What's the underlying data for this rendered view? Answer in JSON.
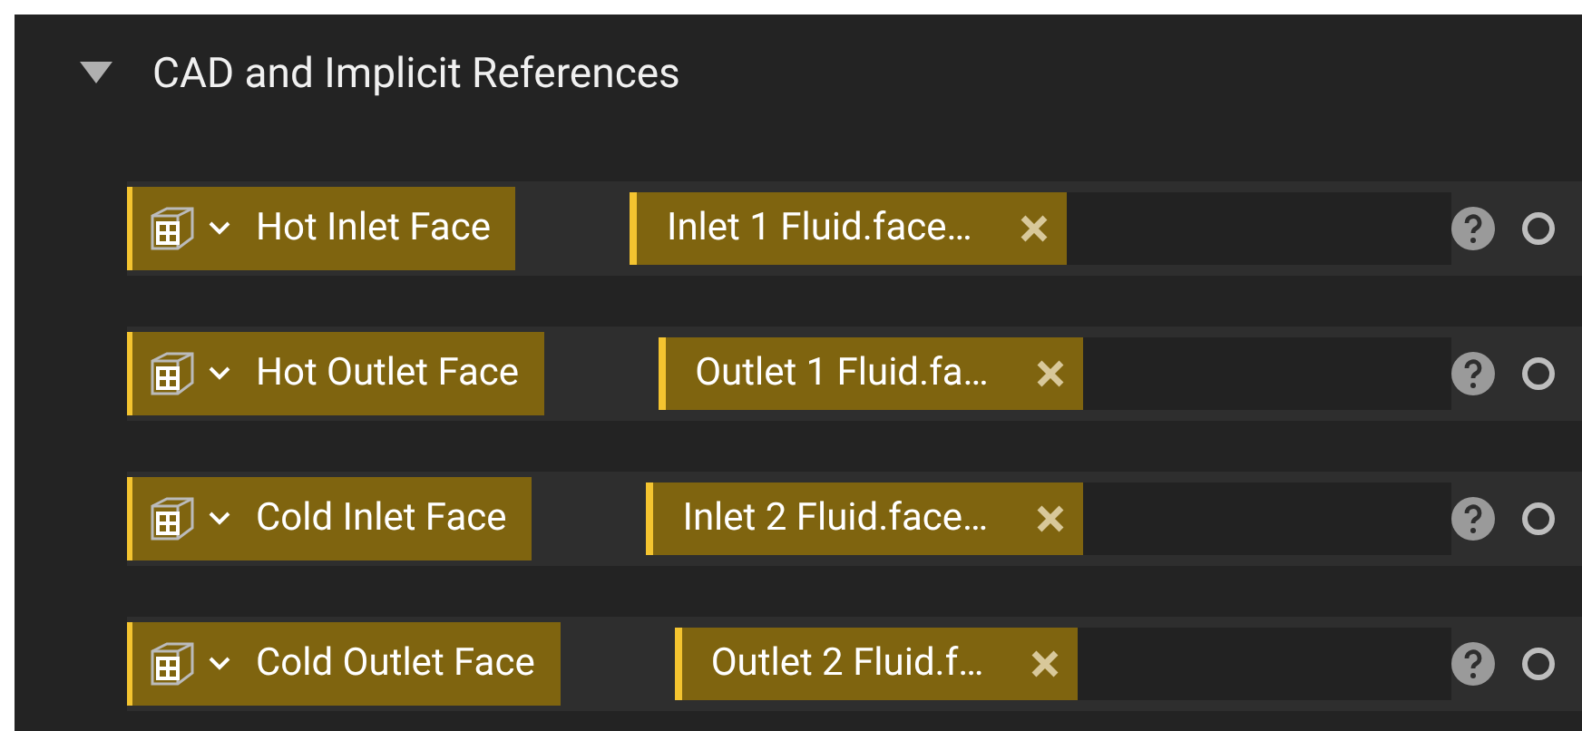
{
  "section": {
    "title": "CAD and Implicit References",
    "expanded": true
  },
  "rows": [
    {
      "label": "Hot Inlet Face",
      "value": "Inlet 1 Fluid.face…"
    },
    {
      "label": "Hot Outlet Face",
      "value": "Outlet 1 Fluid.fa…"
    },
    {
      "label": "Cold Inlet Face",
      "value": "Inlet 2 Fluid.face…"
    },
    {
      "label": "Cold Outlet Face",
      "value": "Outlet 2 Fluid.f…"
    }
  ]
}
